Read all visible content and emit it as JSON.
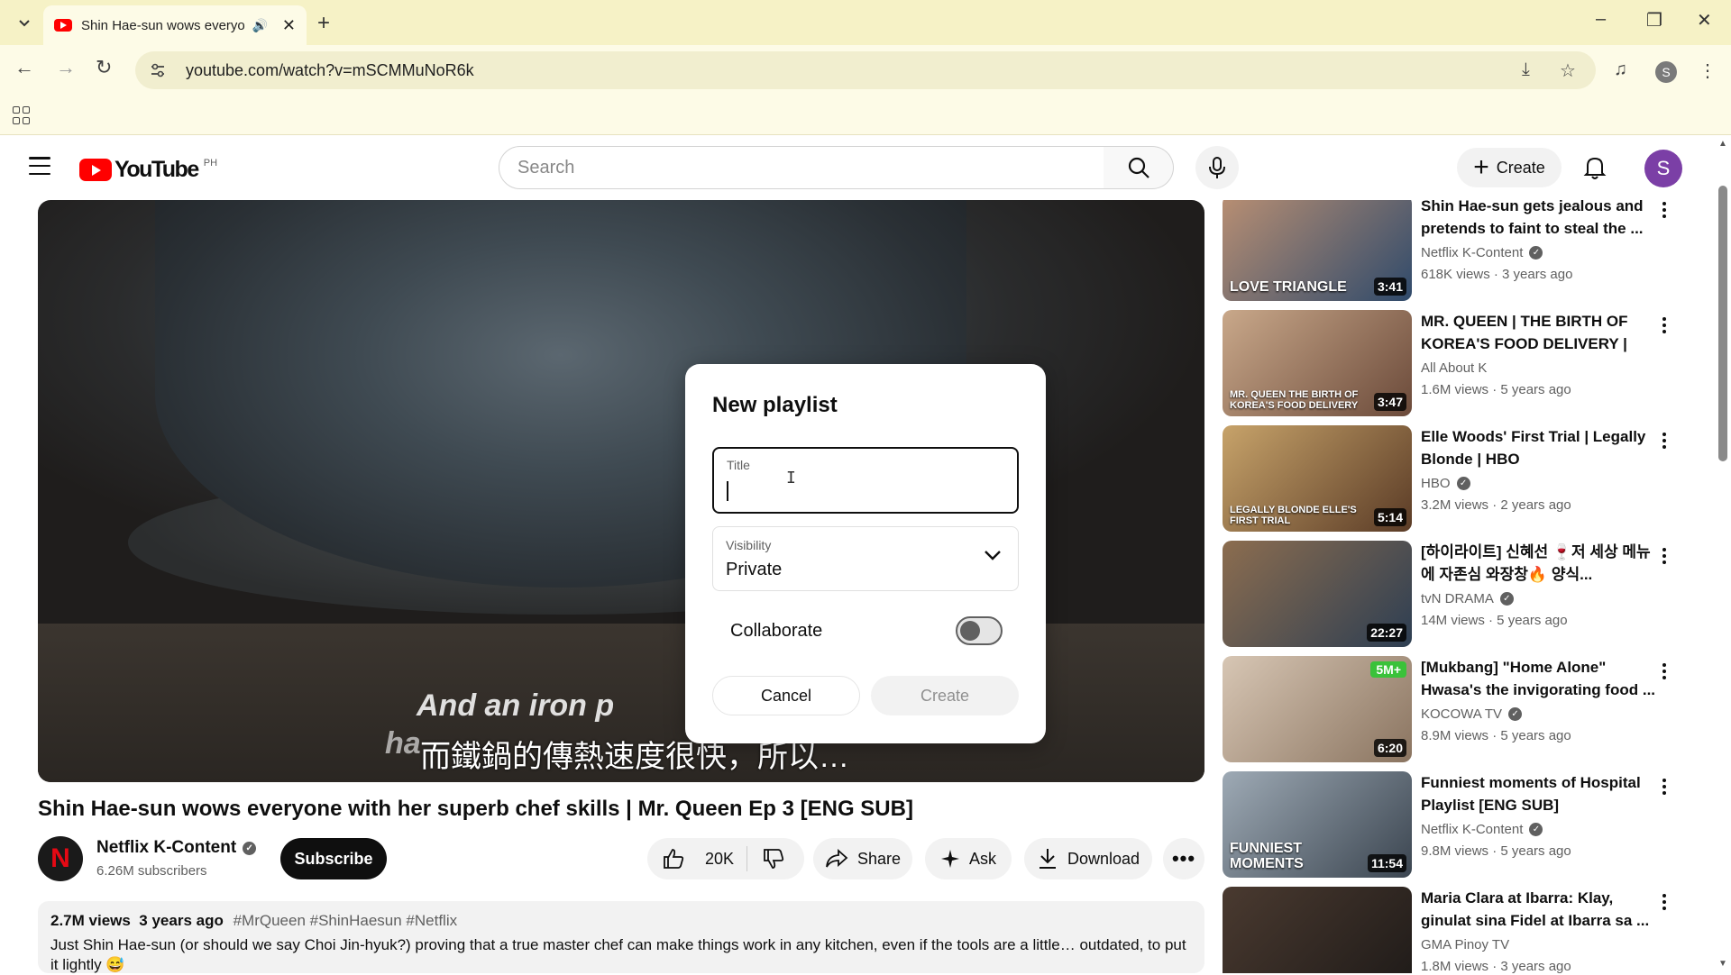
{
  "browser": {
    "tab_title": "Shin Hae-sun wows everyone",
    "url": "youtube.com/watch?v=mSCMMuNoR6k",
    "profile_initial": "S"
  },
  "header": {
    "logo_text": "YouTube",
    "country_code": "PH",
    "search_placeholder": "Search",
    "create_label": "Create",
    "avatar_initial": "S"
  },
  "player": {
    "subtitle_en_line1": "And an iron p",
    "subtitle_en_line2": "ha",
    "subtitle_zh": "而鐵鍋的傳熱速度很快，所以…"
  },
  "video": {
    "title": "Shin Hae-sun wows everyone with her superb chef skills | Mr. Queen Ep 3 [ENG SUB]",
    "channel_name": "Netflix K-Content",
    "channel_initial": "N",
    "subscribers": "6.26M subscribers",
    "subscribe_label": "Subscribe",
    "likes": "20K",
    "share_label": "Share",
    "ask_label": "Ask",
    "download_label": "Download",
    "views": "2.7M views",
    "age": "3 years ago",
    "tags": "#MrQueen #ShinHaesun #Netflix",
    "description": "Just Shin Hae-sun (or should we say Choi Jin-hyuk?) proving that a true master chef can make things work in any kitchen, even if the tools are a little… outdated, to put it lightly 😅"
  },
  "modal": {
    "heading": "New playlist",
    "title_label": "Title",
    "title_value": "",
    "visibility_label": "Visibility",
    "visibility_value": "Private",
    "collaborate_label": "Collaborate",
    "collaborate_on": false,
    "cancel_label": "Cancel",
    "create_label": "Create"
  },
  "recommendations": [
    {
      "title": "Shin Hae-sun gets jealous and pretends to faint to steal the ...",
      "channel": "Netflix K-Content",
      "verified": true,
      "meta": "618K views · 3 years ago",
      "duration": "3:41",
      "thumb_text": "LOVE TRIANGLE",
      "thumb_colors": [
        "#b98f73",
        "#2f4a6b"
      ]
    },
    {
      "title": "MR. QUEEN | THE BIRTH OF KOREA'S FOOD DELIVERY | AL...",
      "channel": "All About K",
      "verified": false,
      "meta": "1.6M views · 5 years ago",
      "duration": "3:47",
      "thumb_text": "MR. QUEEN THE BIRTH OF KOREA'S FOOD DELIVERY",
      "thumb_colors": [
        "#c9a88a",
        "#6b4a3a"
      ]
    },
    {
      "title": "Elle Woods' First Trial | Legally Blonde | HBO",
      "channel": "HBO",
      "verified": true,
      "meta": "3.2M views · 2 years ago",
      "duration": "5:14",
      "thumb_text": "LEGALLY BLONDE ELLE'S FIRST TRIAL",
      "thumb_colors": [
        "#c7a36a",
        "#5a3b26"
      ]
    },
    {
      "title": "[하이라이트] 신혜선 🍷저 세상 메뉴에 자존심 와장창🔥 양식...",
      "channel": "tvN DRAMA",
      "verified": true,
      "meta": "14M views · 5 years ago",
      "duration": "22:27",
      "thumb_text": "",
      "thumb_colors": [
        "#8c6d4f",
        "#2d3e52"
      ]
    },
    {
      "title": "[Mukbang] \"Home Alone\" Hwasa's the invigorating food ...",
      "channel": "KOCOWA TV",
      "verified": true,
      "meta": "8.9M views · 5 years ago",
      "duration": "6:20",
      "thumb_text": "",
      "badge": "5M+",
      "thumb_colors": [
        "#d7c6b4",
        "#8a7460"
      ]
    },
    {
      "title": "Funniest moments of Hospital Playlist [ENG SUB]",
      "channel": "Netflix K-Content",
      "verified": true,
      "meta": "9.8M views · 5 years ago",
      "duration": "11:54",
      "thumb_text": "FUNNIEST MOMENTS",
      "thumb_colors": [
        "#9eaab5",
        "#3b4550"
      ]
    },
    {
      "title": "Maria Clara at Ibarra: Klay, ginulat sina Fidel at Ibarra sa ...",
      "channel": "GMA Pinoy TV",
      "verified": false,
      "meta": "1.8M views · 3 years ago",
      "duration": "",
      "thumb_text": "",
      "thumb_colors": [
        "#4a3a30",
        "#1e1a18"
      ]
    }
  ]
}
